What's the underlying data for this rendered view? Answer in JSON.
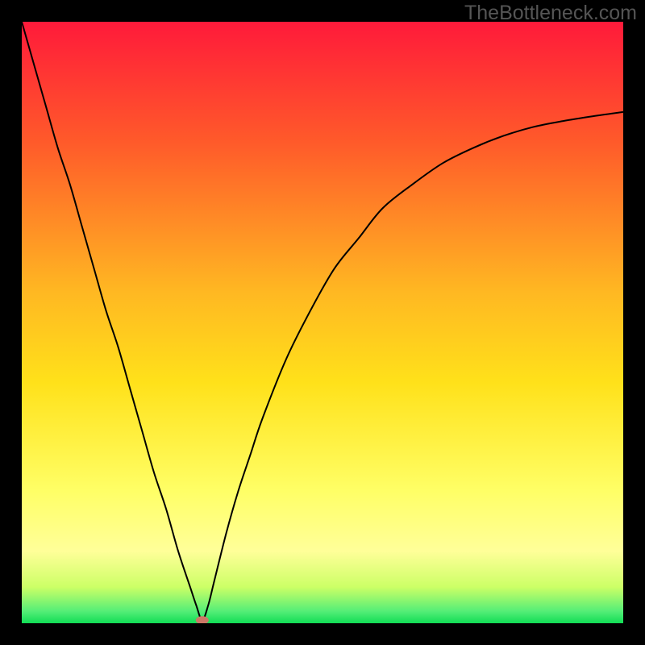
{
  "watermark": "TheBottleneck.com",
  "chart_data": {
    "type": "line",
    "title": "",
    "xlabel": "",
    "ylabel": "",
    "xlim": [
      0,
      100
    ],
    "ylim": [
      0,
      100
    ],
    "grid": false,
    "legend": false,
    "background_gradient_stops": [
      {
        "offset": 0,
        "color": "#ff1a3a"
      },
      {
        "offset": 20,
        "color": "#ff5a2a"
      },
      {
        "offset": 45,
        "color": "#ffb822"
      },
      {
        "offset": 60,
        "color": "#ffe11a"
      },
      {
        "offset": 78,
        "color": "#ffff66"
      },
      {
        "offset": 88,
        "color": "#ffff99"
      },
      {
        "offset": 94,
        "color": "#ccff66"
      },
      {
        "offset": 98,
        "color": "#55ee77"
      },
      {
        "offset": 100,
        "color": "#11dd55"
      }
    ],
    "series": [
      {
        "name": "bottleneck-curve",
        "color": "#000000",
        "stroke_width": 2,
        "x": [
          0,
          2,
          4,
          6,
          8,
          10,
          12,
          14,
          16,
          18,
          20,
          22,
          24,
          26,
          28,
          29,
          30,
          31,
          32,
          34,
          36,
          38,
          40,
          44,
          48,
          52,
          56,
          60,
          65,
          70,
          75,
          80,
          85,
          90,
          95,
          100
        ],
        "y": [
          100,
          93,
          86,
          79,
          73,
          66,
          59,
          52,
          46,
          39,
          32,
          25,
          19,
          12,
          6,
          3,
          0.5,
          3,
          7,
          15,
          22,
          28,
          34,
          44,
          52,
          59,
          64,
          69,
          73,
          76.5,
          79,
          81,
          82.5,
          83.5,
          84.3,
          85
        ]
      }
    ],
    "marker": {
      "name": "current-point",
      "x": 30,
      "y": 0.5,
      "rx": 8,
      "ry": 5,
      "color": "#cc7766"
    }
  }
}
